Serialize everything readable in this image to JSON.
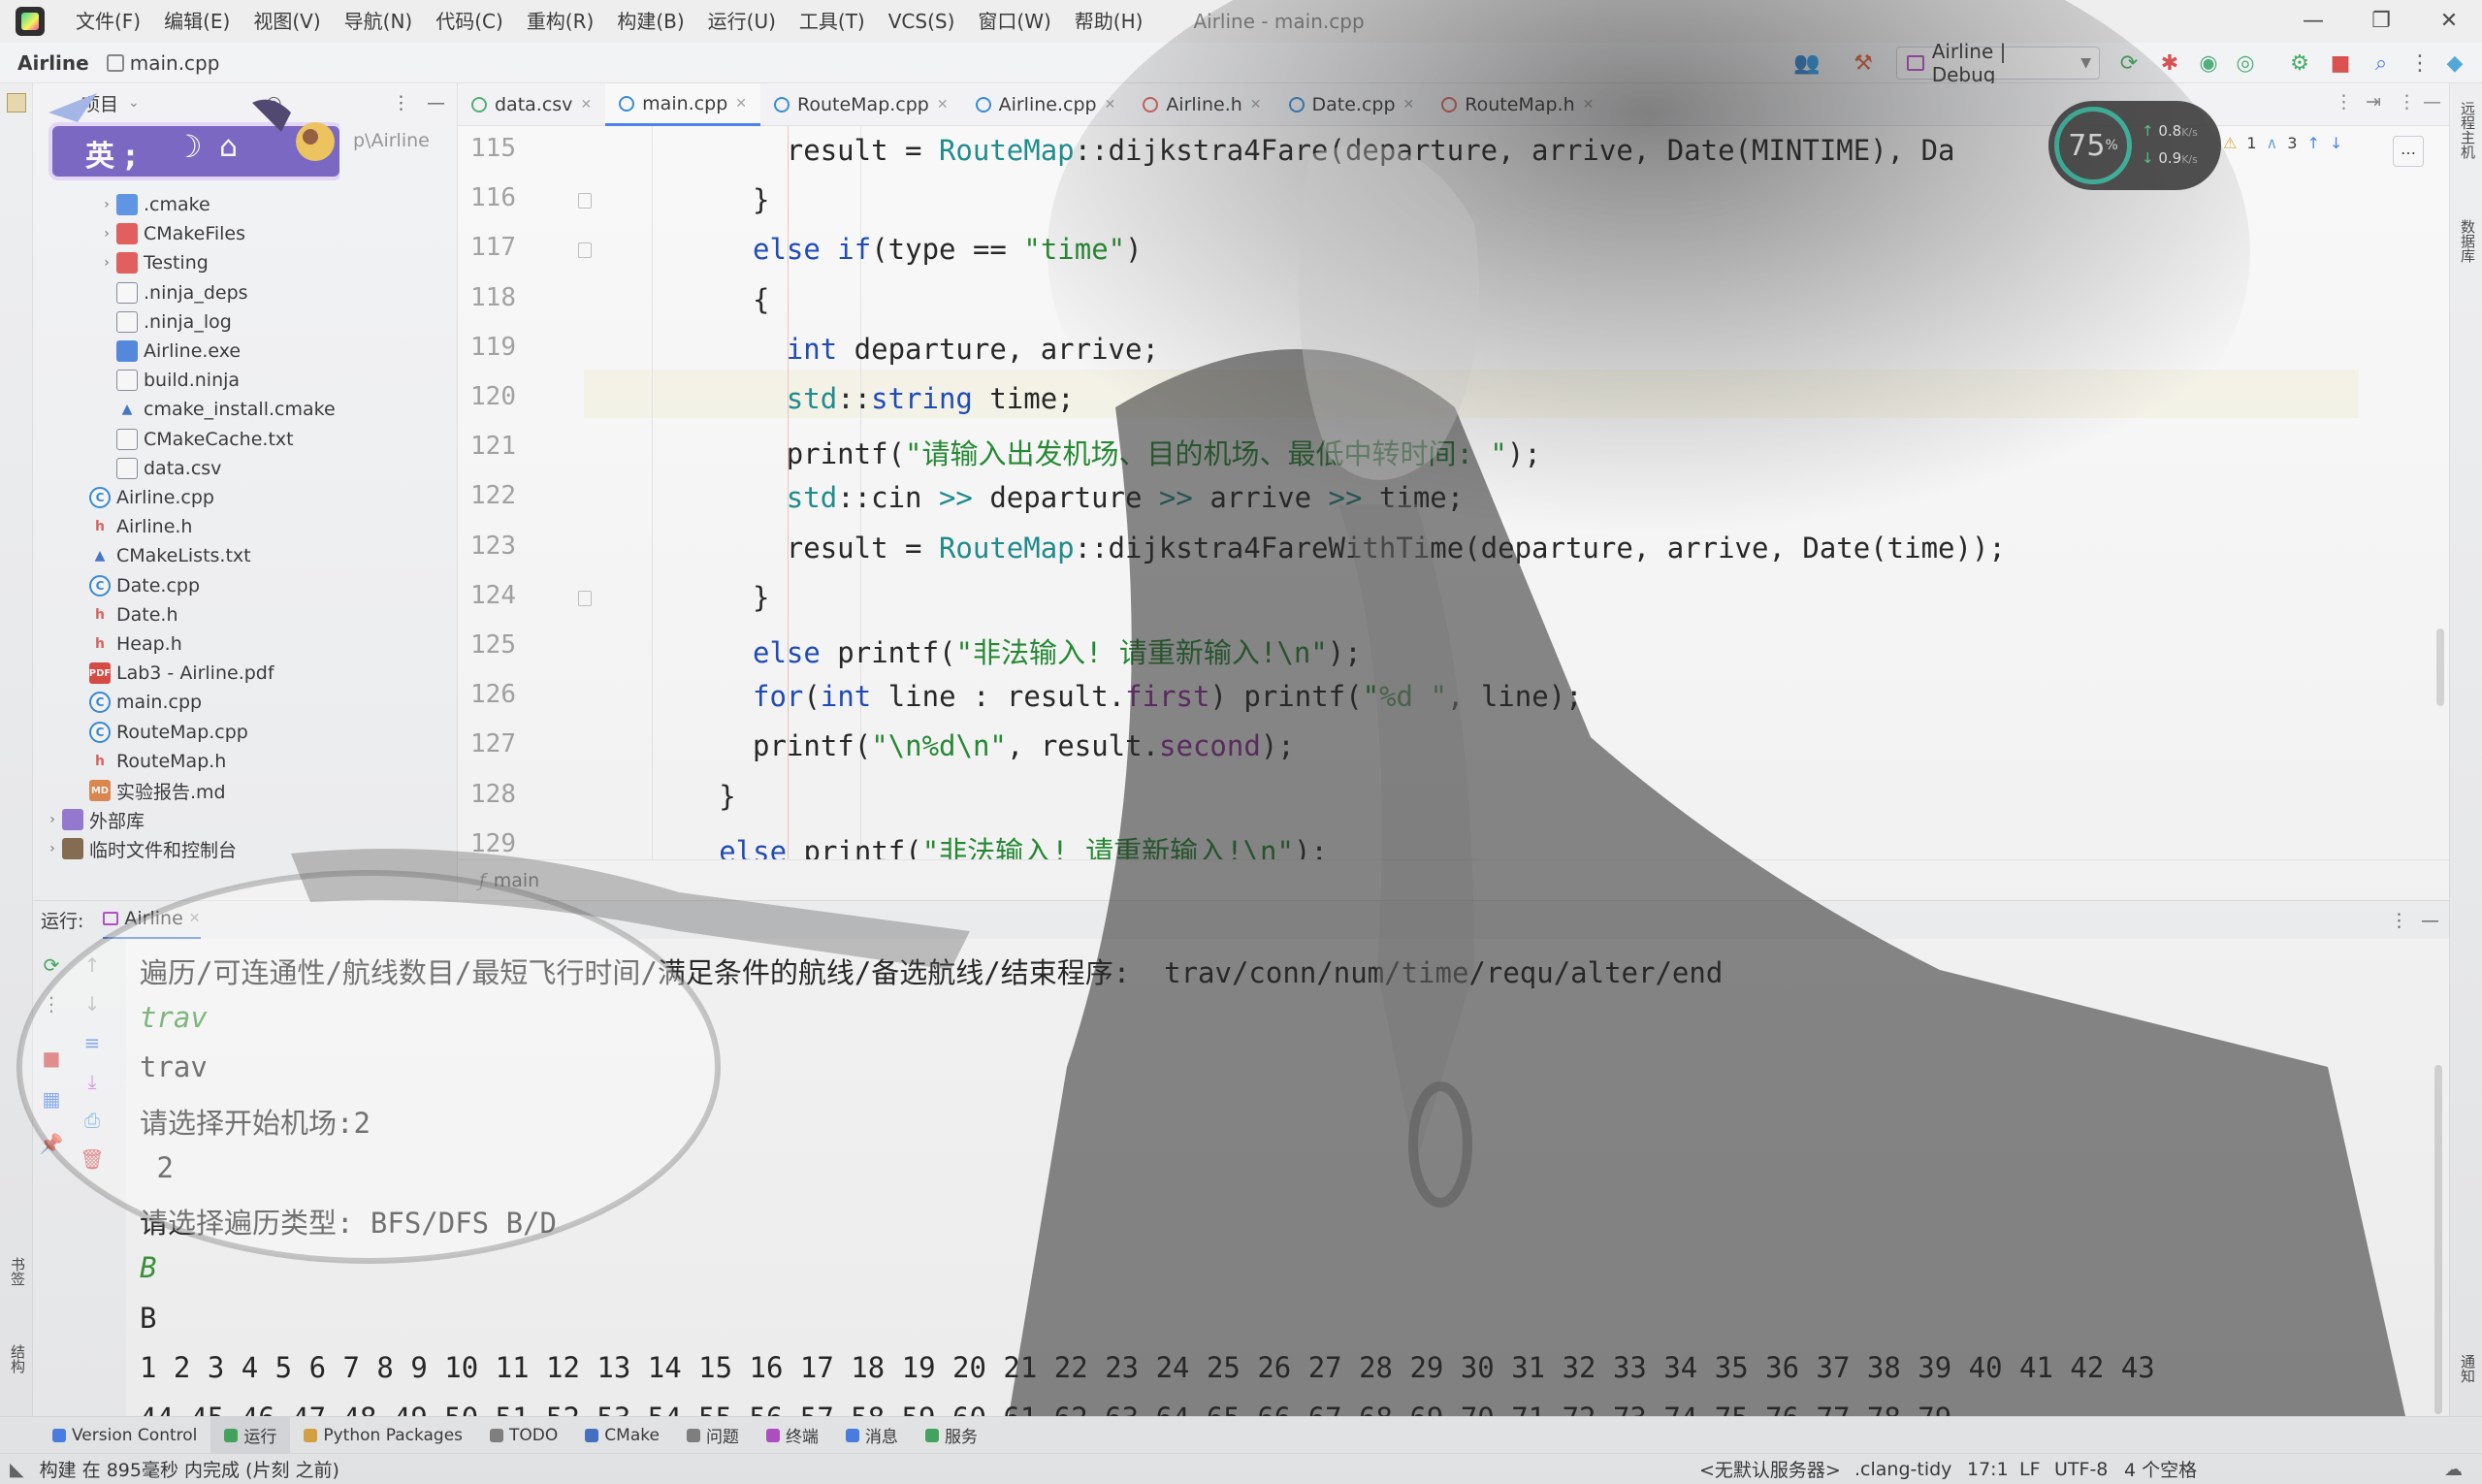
{
  "menubar": {
    "items": [
      "文件(F)",
      "编辑(E)",
      "视图(V)",
      "导航(N)",
      "代码(C)",
      "重构(R)",
      "构建(B)",
      "运行(U)",
      "工具(T)",
      "VCS(S)",
      "窗口(W)",
      "帮助(H)"
    ],
    "window_title": "Airline - main.cpp",
    "minimize": "—",
    "maximize": "❐",
    "close": "✕"
  },
  "navbar": {
    "project": "Airline",
    "file": "main.cpp",
    "run_config": "Airline | Debug"
  },
  "project_panel": {
    "title": "项目",
    "path_fragment": "p\\Airline",
    "badge_text": "英 ;",
    "items": [
      {
        "label": ".cmake",
        "icon": "bfolder",
        "indent": 2,
        "arrow": "›"
      },
      {
        "label": "CMakeFiles",
        "icon": "rfolder",
        "indent": 2,
        "arrow": "›"
      },
      {
        "label": "Testing",
        "icon": "rfolder",
        "indent": 2,
        "arrow": "›"
      },
      {
        "label": ".ninja_deps",
        "icon": "txt",
        "indent": 2,
        "arrow": ""
      },
      {
        "label": ".ninja_log",
        "icon": "txt",
        "indent": 2,
        "arrow": ""
      },
      {
        "label": "Airline.exe",
        "icon": "exe",
        "indent": 2,
        "arrow": ""
      },
      {
        "label": "build.ninja",
        "icon": "txt",
        "indent": 2,
        "arrow": ""
      },
      {
        "label": "cmake_install.cmake",
        "icon": "cm",
        "indent": 2,
        "arrow": ""
      },
      {
        "label": "CMakeCache.txt",
        "icon": "txt",
        "indent": 2,
        "arrow": ""
      },
      {
        "label": "data.csv",
        "icon": "txt",
        "indent": 2,
        "arrow": ""
      },
      {
        "label": "Airline.cpp",
        "icon": "cpp",
        "indent": 1,
        "arrow": ""
      },
      {
        "label": "Airline.h",
        "icon": "h",
        "indent": 1,
        "arrow": ""
      },
      {
        "label": "CMakeLists.txt",
        "icon": "cm",
        "indent": 1,
        "arrow": ""
      },
      {
        "label": "Date.cpp",
        "icon": "cpp",
        "indent": 1,
        "arrow": ""
      },
      {
        "label": "Date.h",
        "icon": "h",
        "indent": 1,
        "arrow": ""
      },
      {
        "label": "Heap.h",
        "icon": "h",
        "indent": 1,
        "arrow": ""
      },
      {
        "label": "Lab3 - Airline.pdf",
        "icon": "pdf",
        "indent": 1,
        "arrow": ""
      },
      {
        "label": "main.cpp",
        "icon": "cpp",
        "indent": 1,
        "arrow": ""
      },
      {
        "label": "RouteMap.cpp",
        "icon": "cpp",
        "indent": 1,
        "arrow": ""
      },
      {
        "label": "RouteMap.h",
        "icon": "h",
        "indent": 1,
        "arrow": ""
      },
      {
        "label": "实验报告.md",
        "icon": "md",
        "indent": 1,
        "arrow": ""
      },
      {
        "label": "外部库",
        "icon": "lib",
        "indent": 0,
        "arrow": "›"
      },
      {
        "label": "临时文件和控制台",
        "icon": "tmp",
        "indent": 0,
        "arrow": "›"
      }
    ]
  },
  "tabs": [
    {
      "label": "data.csv",
      "icon": "csv-icon",
      "active": false
    },
    {
      "label": "main.cpp",
      "icon": "cpp-icon",
      "active": true
    },
    {
      "label": "RouteMap.cpp",
      "icon": "cpp-icon",
      "active": false
    },
    {
      "label": "Airline.cpp",
      "icon": "cpp-icon",
      "active": false
    },
    {
      "label": "Airline.h",
      "icon": "header-icon",
      "active": false
    },
    {
      "label": "Date.cpp",
      "icon": "cpp-icon",
      "active": false
    },
    {
      "label": "RouteMap.h",
      "icon": "header-icon",
      "active": false
    }
  ],
  "editor": {
    "inspection": {
      "warnings": "1",
      "weak": "3"
    },
    "current_line": "120",
    "lines": [
      {
        "n": "115",
        "indent": 12,
        "tokens": [
          [
            "",
            "result = "
          ],
          [
            "cls",
            "RouteMap"
          ],
          [
            "",
            "::dijkstra4Fare(departure, arrive, Date(MINTIME), Da"
          ]
        ]
      },
      {
        "n": "116",
        "indent": 10,
        "tokens": [
          [
            "",
            "}"
          ]
        ]
      },
      {
        "n": "117",
        "indent": 10,
        "tokens": [
          [
            "kw",
            "else if"
          ],
          [
            "",
            "(type == "
          ],
          [
            "str",
            "\"time\""
          ],
          [
            "",
            ")"
          ]
        ]
      },
      {
        "n": "118",
        "indent": 10,
        "tokens": [
          [
            "",
            "{"
          ]
        ]
      },
      {
        "n": "119",
        "indent": 12,
        "tokens": [
          [
            "kw",
            "int"
          ],
          [
            "",
            " departure, arrive;"
          ]
        ]
      },
      {
        "n": "120",
        "indent": 12,
        "tokens": [
          [
            "cls",
            "std"
          ],
          [
            "",
            "::"
          ],
          [
            "ctype",
            "string"
          ],
          [
            "",
            " time;"
          ]
        ]
      },
      {
        "n": "121",
        "indent": 12,
        "tokens": [
          [
            "",
            "printf("
          ],
          [
            "str",
            "\"请输入出发机场、目的机场、最低中转时间: \""
          ],
          [
            "",
            ");"
          ]
        ]
      },
      {
        "n": "122",
        "indent": 12,
        "tokens": [
          [
            "cls",
            "std"
          ],
          [
            "",
            "::cin "
          ],
          [
            "cls",
            ">>"
          ],
          [
            "",
            " departure "
          ],
          [
            "cls",
            ">>"
          ],
          [
            "",
            " arrive "
          ],
          [
            "cls",
            ">>"
          ],
          [
            "",
            " time;"
          ]
        ]
      },
      {
        "n": "123",
        "indent": 12,
        "tokens": [
          [
            "",
            "result = "
          ],
          [
            "cls",
            "RouteMap"
          ],
          [
            "",
            "::dijkstra4FareWithTime(departure, arrive, Date(time));"
          ]
        ]
      },
      {
        "n": "124",
        "indent": 10,
        "tokens": [
          [
            "",
            "}"
          ]
        ]
      },
      {
        "n": "125",
        "indent": 10,
        "tokens": [
          [
            "kw",
            "else"
          ],
          [
            "",
            " printf("
          ],
          [
            "str",
            "\"非法输入! 请重新输入!\\n\""
          ],
          [
            "",
            ");"
          ]
        ]
      },
      {
        "n": "126",
        "indent": 10,
        "tokens": [
          [
            "kw",
            "for"
          ],
          [
            "",
            "("
          ],
          [
            "kw",
            "int"
          ],
          [
            "",
            " line : result."
          ],
          [
            "fld",
            "first"
          ],
          [
            "",
            ") printf("
          ],
          [
            "str",
            "\"%d \""
          ],
          [
            "",
            ", line);"
          ]
        ]
      },
      {
        "n": "127",
        "indent": 10,
        "tokens": [
          [
            "",
            "printf("
          ],
          [
            "str",
            "\"\\n%d\\n\""
          ],
          [
            "",
            ", result."
          ],
          [
            "fld",
            "second"
          ],
          [
            "",
            ");"
          ]
        ]
      },
      {
        "n": "128",
        "indent": 8,
        "tokens": [
          [
            "",
            "}"
          ]
        ]
      },
      {
        "n": "129",
        "indent": 8,
        "tokens": [
          [
            "kw",
            "else"
          ],
          [
            "",
            " printf("
          ],
          [
            "str",
            "\"非法输入! 请重新输入!\\n\""
          ],
          [
            "",
            ");"
          ]
        ]
      }
    ],
    "breadcrumb": "main"
  },
  "run": {
    "label": "运行:",
    "tab": "Airline",
    "output": [
      {
        "text": "遍历/可连通性/航线数目/最短飞行时间/满足条件的航线/备选航线/结束程序:  trav/conn/num/time/requ/alter/end",
        "input": false
      },
      {
        "text": "trav",
        "input": true
      },
      {
        "text": "trav",
        "input": false
      },
      {
        "text": "请选择开始机场:2",
        "input": false,
        "mixed": true
      },
      {
        "text": " 2",
        "input": false
      },
      {
        "text": "请选择遍历类型: BFS/DFS B/D",
        "input": false
      },
      {
        "text": "B",
        "input": true
      },
      {
        "text": "B",
        "input": false
      },
      {
        "text": "1 2 3 4 5 6 7 8 9 10 11 12 13 14 15 16 17 18 19 20 21 22 23 24 25 26 27 28 29 30 31 32 33 34 35 36 37 38 39 40 41 42 43",
        "input": false
      },
      {
        "text": "44 45 46 47 48 49 50 51 52 53 54 55 56 57 58 59 60 61 62 63 64 65 66 67 68 69 70 71 72 73 74 75 76 77 78 79",
        "input": false
      }
    ]
  },
  "toolwindows": [
    "Version Control",
    "运行",
    "Python Packages",
    "TODO",
    "CMake",
    "问题",
    "终端",
    "消息",
    "服务"
  ],
  "statusbar": {
    "message": "构建 在 895毫秒 内完成 (片刻 之前)",
    "server": "<无默认服务器>",
    "linter": ".clang-tidy",
    "position": "17:1",
    "line_sep": "LF",
    "encoding": "UTF-8",
    "indent": "4 个空格"
  },
  "side_labels": {
    "right_top": "远程主机",
    "right_mid": "数据库",
    "right_bottom": "通知",
    "left_bookmarks": "书签",
    "left_structure": "结构"
  },
  "net_widget": {
    "percent": "75",
    "percent_unit": "%",
    "up": "0.8",
    "down": "0.9",
    "unit": "K/s"
  },
  "colors": {
    "accent": "#3574f0",
    "keyword": "#0033b3",
    "string": "#067d17",
    "class": "#008080",
    "field": "#871094",
    "console_input": "#1f8a1f"
  }
}
